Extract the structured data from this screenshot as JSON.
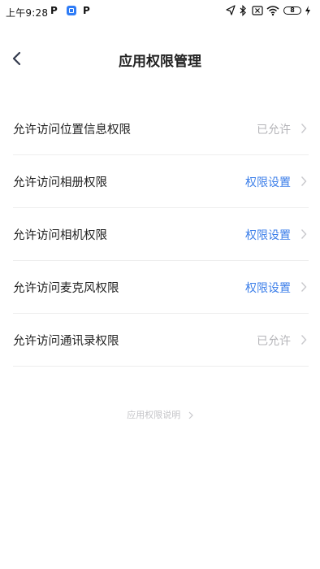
{
  "status_bar": {
    "time": "上午9:28",
    "battery_level": "8",
    "icons": [
      "p-notification-icon",
      "app-blue-icon",
      "p-notification-icon",
      "location-arrow-icon",
      "bluetooth-icon",
      "sim-off-icon",
      "wifi-icon",
      "battery-icon",
      "charging-bolt-icon"
    ]
  },
  "header": {
    "title": "应用权限管理",
    "back_icon": "chevron-left-icon"
  },
  "permissions": [
    {
      "label": "允许访问位置信息权限",
      "status": "已允许",
      "state": "allowed"
    },
    {
      "label": "允许访问相册权限",
      "status": "权限设置",
      "state": "set"
    },
    {
      "label": "允许访问相机权限",
      "status": "权限设置",
      "state": "set"
    },
    {
      "label": "允许访问麦克风权限",
      "status": "权限设置",
      "state": "set"
    },
    {
      "label": "允许访问通讯录权限",
      "status": "已允许",
      "state": "allowed"
    }
  ],
  "footer": {
    "explain_link": "应用权限说明"
  },
  "colors": {
    "link_blue": "#3b7ee9",
    "muted_gray": "#b4b4b8",
    "divider": "#eeeeee"
  }
}
